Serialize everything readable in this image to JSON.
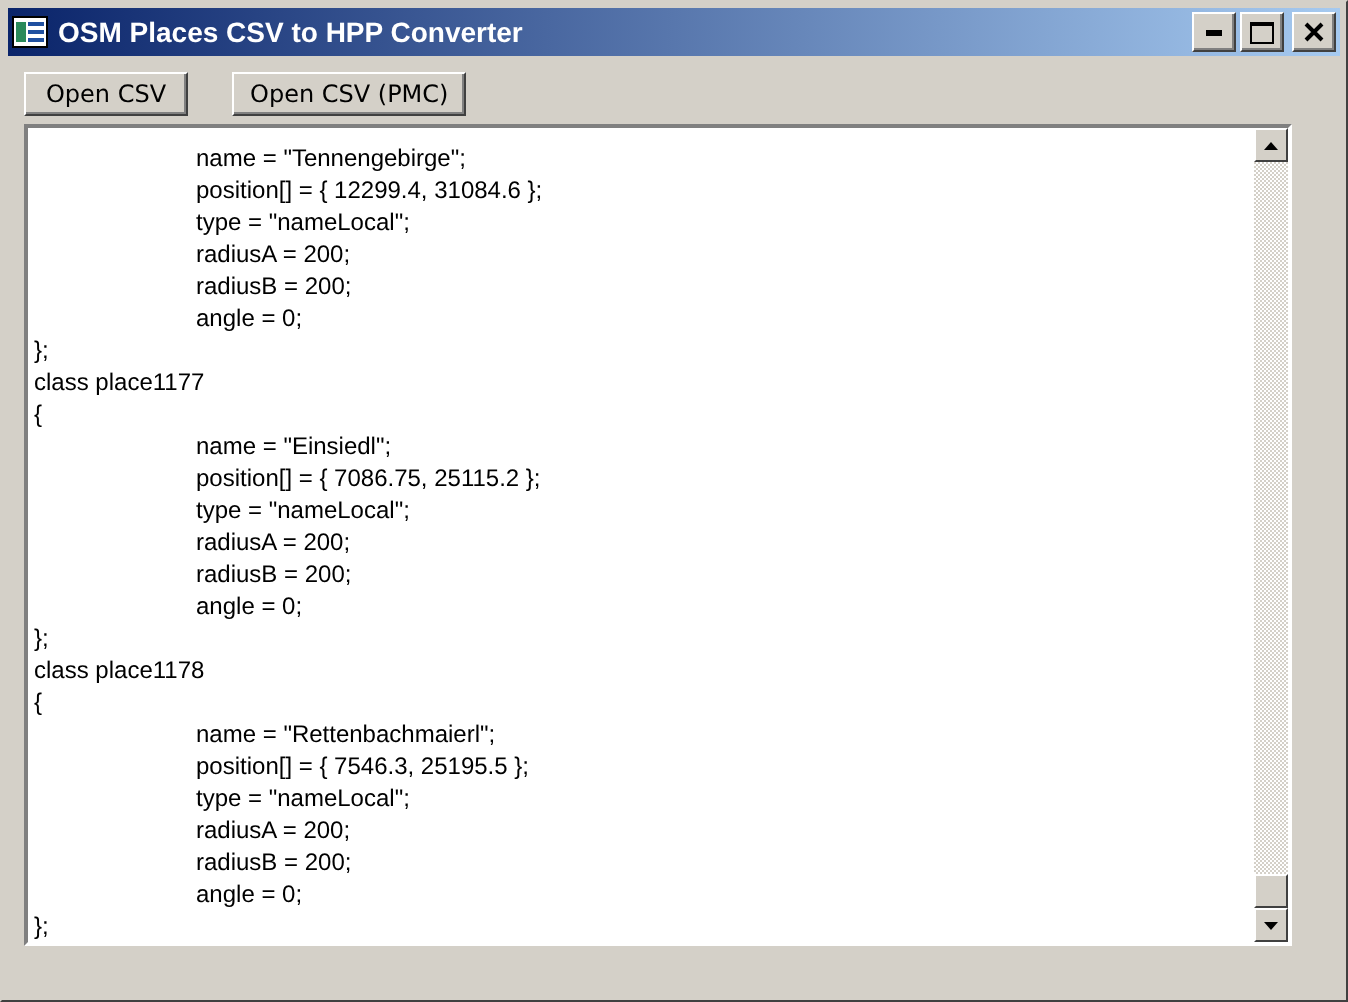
{
  "window": {
    "title": "OSM Places CSV to HPP Converter"
  },
  "buttons": [
    "Open CSV",
    "Open CSV (PMC)"
  ],
  "editor": {
    "lines": [
      "\tname = \"Tennengebirge\";",
      "\tposition[] = { 12299.4, 31084.6 };",
      "\ttype = \"nameLocal\";",
      "\tradiusA = 200;",
      "\tradiusB = 200;",
      "\tangle = 0;",
      "};",
      "class place1177",
      "{",
      "\tname = \"Einsiedl\";",
      "\tposition[] = { 7086.75, 25115.2 };",
      "\ttype = \"nameLocal\";",
      "\tradiusA = 200;",
      "\tradiusB = 200;",
      "\tangle = 0;",
      "};",
      "class place1178",
      "{",
      "\tname = \"Rettenbachmaierl\";",
      "\tposition[] = { 7546.3, 25195.5 };",
      "\ttype = \"nameLocal\";",
      "\tradiusA = 200;",
      "\tradiusB = 200;",
      "\tangle = 0;",
      "};"
    ]
  }
}
